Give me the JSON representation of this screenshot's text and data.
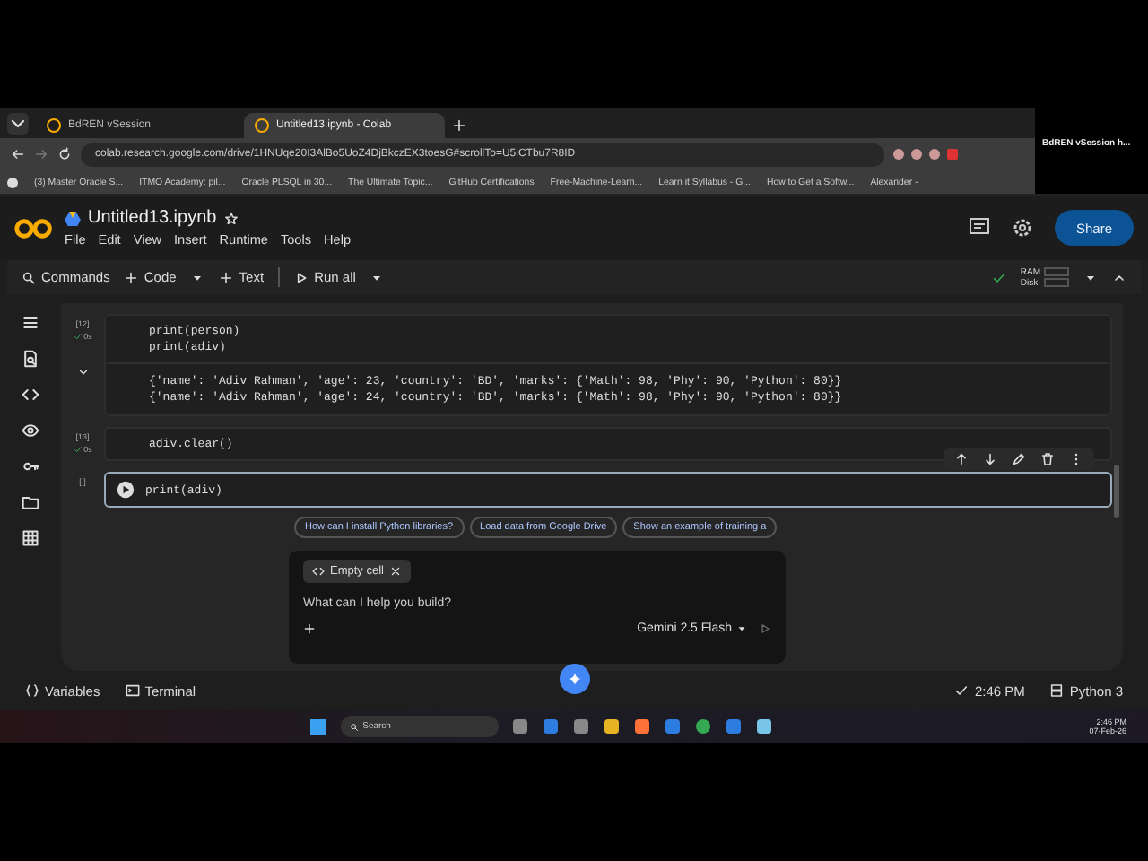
{
  "browser": {
    "tabs": [
      {
        "title": "BdREN vSession",
        "selected": false
      },
      {
        "title": "Untitled13.ipynb - Colab",
        "selected": true
      }
    ],
    "url": "colab.research.google.com/drive/1HNUqe20I3AlBo5UoZ4DjBkczEX3toesG#scrollTo=U5iCTbu7R8ID",
    "bookmarks": [
      "(3) Master Oracle S...",
      "ITMO Academy: pil...",
      "Oracle PLSQL in 30...",
      "The Ultimate Topic...",
      "GitHub Certifications",
      "Free-Machine-Learn...",
      "Learn it Syllabus - G...",
      "How to Get a Softw...",
      "Alexander -"
    ],
    "overlay_label": "BdREN vSession h..."
  },
  "colab": {
    "file_name": "Untitled13.ipynb",
    "menu": [
      "File",
      "Edit",
      "View",
      "Insert",
      "Runtime",
      "Tools",
      "Help"
    ],
    "share": "Share",
    "toolbar": {
      "commands": "Commands",
      "code": "Code",
      "text": "Text",
      "run_all": "Run all",
      "ram": "RAM",
      "disk": "Disk"
    }
  },
  "cells": [
    {
      "exec": "[12]",
      "time": "0s",
      "selected": false,
      "lines": [
        "print(person)",
        "print(adiv)"
      ],
      "output": [
        "{'name': 'Adiv Rahman', 'age': 23, 'country': 'BD', 'marks': {'Math': 98, 'Phy': 90, 'Python': 80}}",
        "{'name': 'Adiv Rahman', 'age': 24, 'country': 'BD', 'marks': {'Math': 98, 'Phy': 90, 'Python': 80}}"
      ]
    },
    {
      "exec": "[13]",
      "time": "0s",
      "selected": false,
      "lines": [
        "adiv.clear()"
      ]
    },
    {
      "exec": "[ ]",
      "selected": true,
      "lines": [
        "print(adiv)"
      ]
    }
  ],
  "suggestions": [
    "How can I install Python libraries?",
    "Load data from Google Drive",
    "Show an example of training a"
  ],
  "chat": {
    "chip": "Empty cell",
    "placeholder": "What can I help you build?",
    "model": "Gemini 2.5 Flash"
  },
  "status_bar": {
    "variables": "Variables",
    "terminal": "Terminal",
    "time": "2:46 PM",
    "runtime": "Python 3"
  },
  "taskbar": {
    "search": "Search",
    "clock": "2:46 PM",
    "date": "07-Feb-26"
  }
}
